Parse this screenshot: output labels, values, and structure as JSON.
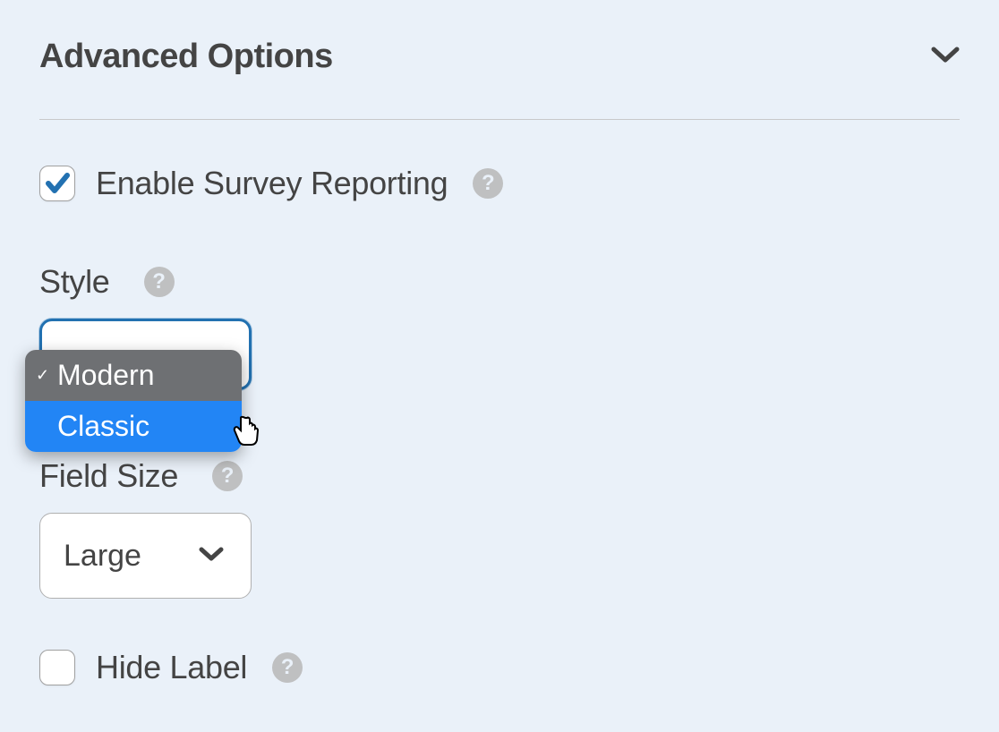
{
  "section": {
    "title": "Advanced Options"
  },
  "survey": {
    "label": "Enable Survey Reporting",
    "checked": true
  },
  "style": {
    "label": "Style",
    "options": [
      "Modern",
      "Classic"
    ],
    "selected": "Modern",
    "highlighted": "Classic"
  },
  "fieldSize": {
    "label": "Field Size",
    "value": "Large"
  },
  "hideLabel": {
    "label": "Hide Label",
    "checked": false
  }
}
